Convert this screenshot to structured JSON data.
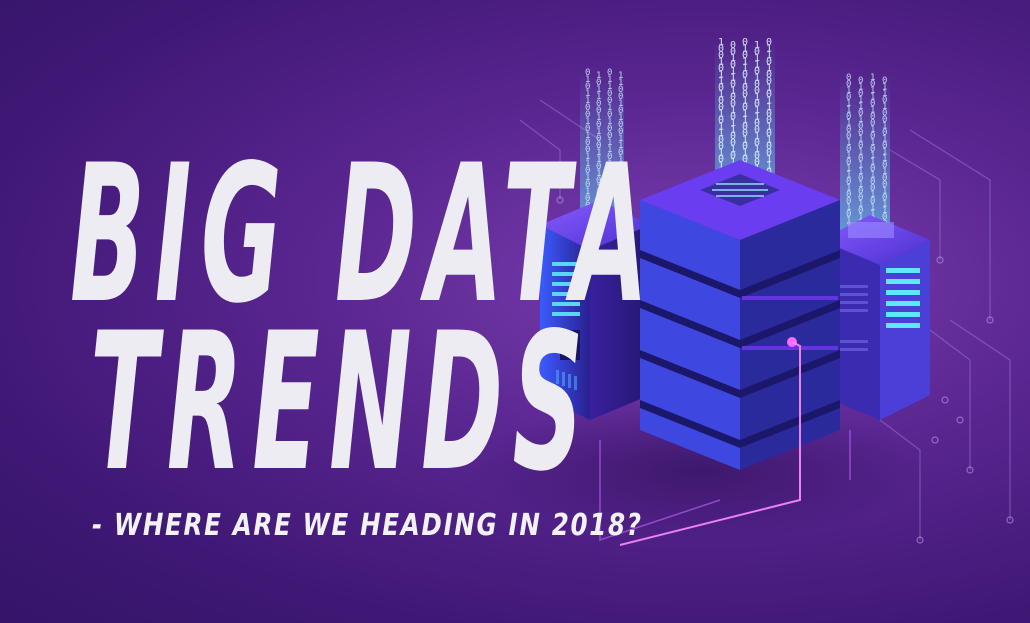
{
  "headline": {
    "line1": "BIG DATA",
    "line2": "TRENDS",
    "subtitle": "- WHERE ARE WE HEADING IN 2018?"
  },
  "illustration": {
    "subject": "isometric server racks with binary data streams",
    "binary_streams": [
      [
        "0",
        "1",
        "0",
        "1",
        "1",
        "0",
        "0",
        "1",
        "0",
        "1",
        "0",
        "0",
        "1",
        "1",
        "0",
        "1",
        "0",
        "1",
        "0",
        "0",
        "1",
        "1",
        "0",
        "1",
        "0",
        "1"
      ],
      [
        "1",
        "0",
        "0",
        "1",
        "0",
        "1",
        "1",
        "0",
        "1",
        "0",
        "0",
        "1",
        "0",
        "1",
        "1",
        "0",
        "0",
        "1",
        "0",
        "1",
        "0",
        "0",
        "1",
        "1",
        "0",
        "1"
      ],
      [
        "0",
        "0",
        "1",
        "0",
        "1",
        "1",
        "0",
        "1",
        "0",
        "0",
        "1",
        "0",
        "1",
        "0",
        "1",
        "1",
        "0",
        "1",
        "0",
        "0",
        "1",
        "0",
        "1",
        "1",
        "0",
        "0"
      ]
    ]
  },
  "colors": {
    "background": "#4a1f82",
    "background_glow": "#7a3fb0",
    "text": "#ececf2",
    "server_top": "#6a3df0",
    "server_side": "#2e1f9a",
    "accent_cyan": "#5ee7ff",
    "glow_pink": "#ff6bff"
  }
}
